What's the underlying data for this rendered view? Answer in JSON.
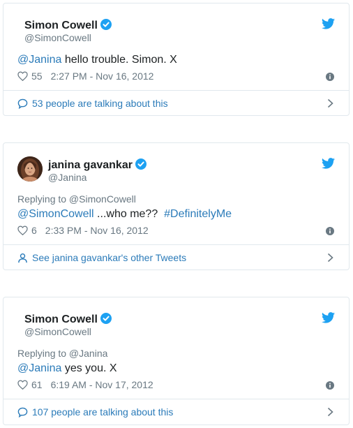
{
  "colors": {
    "link": "#2b7bb9",
    "text": "#1c2022",
    "muted": "#697882",
    "border": "#e1e8ed",
    "twitter_blue": "#1da1f2"
  },
  "tweets": [
    {
      "name": "Simon Cowell",
      "handle": "@SimonCowell",
      "replying_to": "",
      "mention": "@Janina",
      "body": " hello trouble. Simon. X",
      "hashtag": "",
      "likes": "55",
      "time": "2:27 PM - Nov 16, 2012",
      "footer": "53 people are talking about this",
      "footer_icon": "speech-bubble-icon"
    },
    {
      "name": "janina gavankar",
      "handle": "@Janina",
      "replying_to": "Replying to @SimonCowell",
      "mention": "@SimonCowell",
      "body": " ...who me??  ",
      "hashtag": "#DefinitelyMe",
      "likes": "6",
      "time": "2:33 PM - Nov 16, 2012",
      "footer": "See janina gavankar's other Tweets",
      "footer_icon": "person-icon"
    },
    {
      "name": "Simon Cowell",
      "handle": "@SimonCowell",
      "replying_to": "Replying to @Janina",
      "mention": "@Janina",
      "body": " yes you. X",
      "hashtag": "",
      "likes": "61",
      "time": "6:19 AM - Nov 17, 2012",
      "footer": "107 people are talking about this",
      "footer_icon": "speech-bubble-icon"
    }
  ]
}
